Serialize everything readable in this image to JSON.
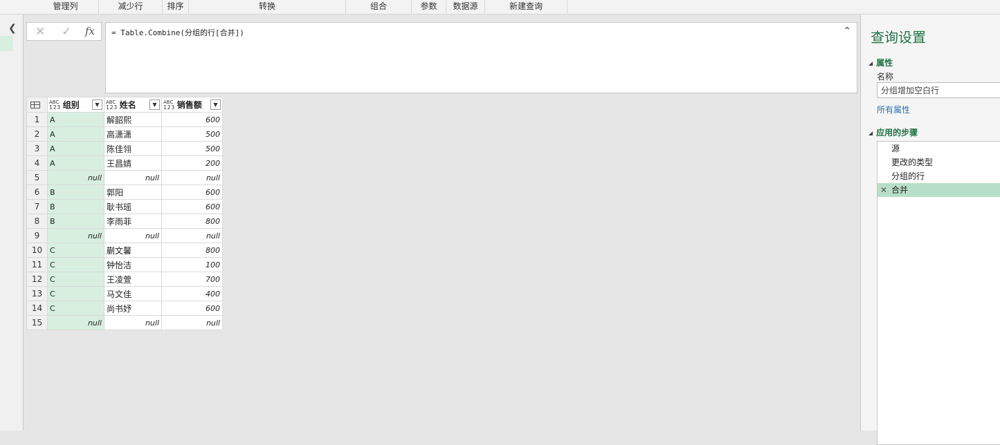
{
  "ribbon": {
    "groups": [
      "管理列",
      "减少行",
      "排序",
      "转换",
      "组合",
      "参数",
      "数据源",
      "新建查询"
    ]
  },
  "nav": {
    "collapse_icon": "chevron-left-icon"
  },
  "formula_bar": {
    "cancel_icon": "✕",
    "commit_icon": "✓",
    "fx_label": "fx",
    "formula": "= Table.Combine(分组的行[合并])"
  },
  "grid": {
    "columns": [
      {
        "type_top": "ABC",
        "type_bottom": "123",
        "name": "组别"
      },
      {
        "type_top": "ABC",
        "type_bottom": "123",
        "name": "姓名"
      },
      {
        "type_top": "ABC",
        "type_bottom": "123",
        "name": "销售额"
      }
    ],
    "rows": [
      {
        "n": "1",
        "group": "A",
        "name": "解韶熙",
        "sales": "600"
      },
      {
        "n": "2",
        "group": "A",
        "name": "高潇潇",
        "sales": "500"
      },
      {
        "n": "3",
        "group": "A",
        "name": "陈佳翎",
        "sales": "500"
      },
      {
        "n": "4",
        "group": "A",
        "name": "王昌婧",
        "sales": "200"
      },
      {
        "n": "5",
        "group": "null",
        "name": "null",
        "sales": "null"
      },
      {
        "n": "6",
        "group": "B",
        "name": "郭阳",
        "sales": "600"
      },
      {
        "n": "7",
        "group": "B",
        "name": "耿书瑶",
        "sales": "600"
      },
      {
        "n": "8",
        "group": "B",
        "name": "李雨菲",
        "sales": "800"
      },
      {
        "n": "9",
        "group": "null",
        "name": "null",
        "sales": "null"
      },
      {
        "n": "10",
        "group": "C",
        "name": "蒯文馨",
        "sales": "800"
      },
      {
        "n": "11",
        "group": "C",
        "name": "钟怡洁",
        "sales": "100"
      },
      {
        "n": "12",
        "group": "C",
        "name": "王凌萱",
        "sales": "700"
      },
      {
        "n": "13",
        "group": "C",
        "name": "马文佳",
        "sales": "400"
      },
      {
        "n": "14",
        "group": "C",
        "name": "尚书妤",
        "sales": "600"
      },
      {
        "n": "15",
        "group": "null",
        "name": "null",
        "sales": "null"
      }
    ]
  },
  "settings": {
    "title": "查询设置",
    "properties_header": "属性",
    "name_label": "名称",
    "name_value": "分组增加空白行",
    "all_properties": "所有属性",
    "steps_header": "应用的步骤",
    "steps": [
      "源",
      "更改的类型",
      "分组的行",
      "合并"
    ],
    "active_step": 3
  }
}
